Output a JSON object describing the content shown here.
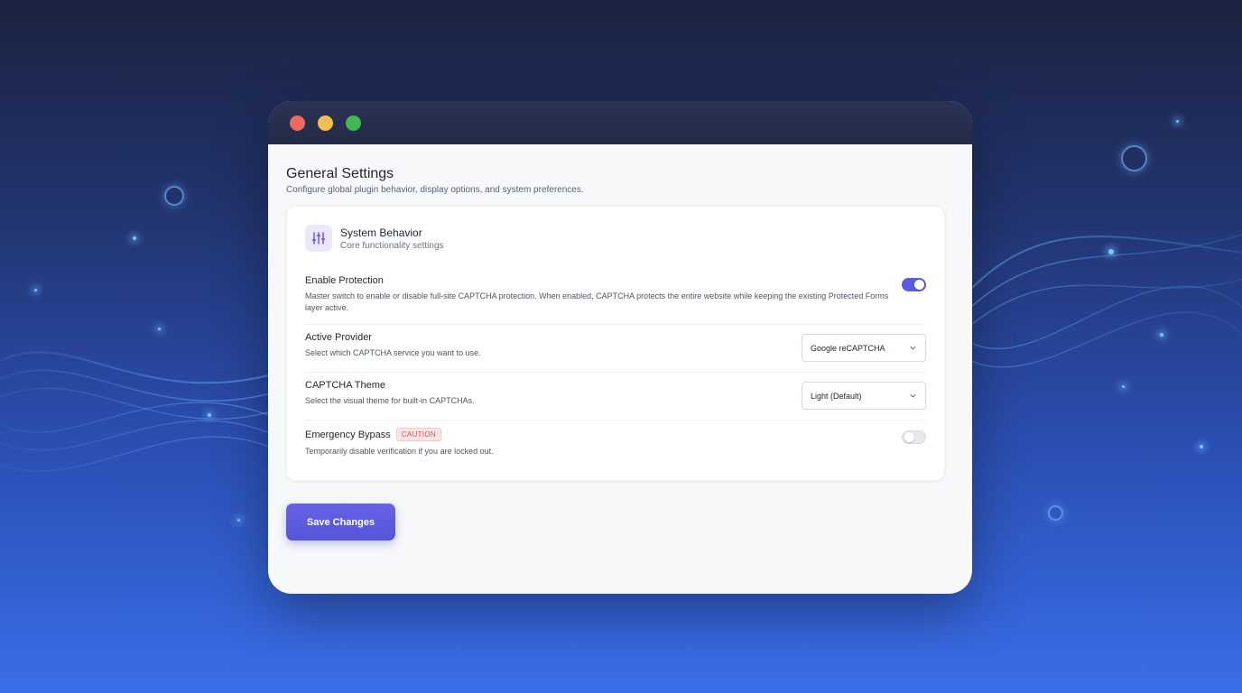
{
  "page": {
    "title": "General Settings",
    "subtitle": "Configure global plugin behavior, display options, and system preferences."
  },
  "card": {
    "icon": "sliders-icon",
    "title": "System Behavior",
    "subtitle": "Core functionality settings"
  },
  "settings": {
    "enable_protection": {
      "label": "Enable Protection",
      "description": "Master switch to enable or disable full-site CAPTCHA protection. When enabled, CAPTCHA protects the entire website while keeping the existing Protected Forms layer active.",
      "enabled": true
    },
    "active_provider": {
      "label": "Active Provider",
      "description": "Select which CAPTCHA service you want to use.",
      "selected": "Google reCAPTCHA"
    },
    "captcha_theme": {
      "label": "CAPTCHA Theme",
      "description": "Select the visual theme for built-in CAPTCHAs.",
      "selected": "Light (Default)"
    },
    "emergency_bypass": {
      "label": "Emergency Bypass",
      "badge": "CAUTION",
      "description": "Temporarily disable verification if you are locked out.",
      "enabled": false
    }
  },
  "actions": {
    "save_label": "Save Changes"
  },
  "colors": {
    "accent": "#5b5bdf",
    "caution": "#d9534f",
    "traffic_red": "#ec6a5e",
    "traffic_yellow": "#f3be4f",
    "traffic_green": "#3fb950"
  }
}
